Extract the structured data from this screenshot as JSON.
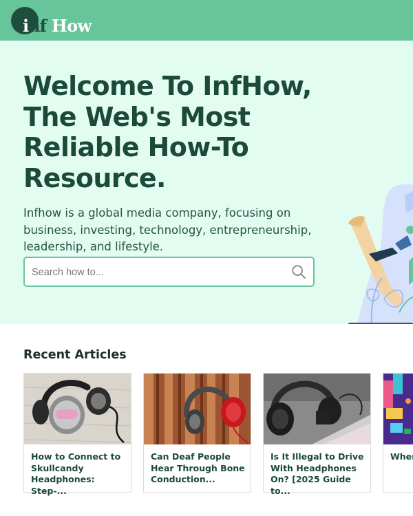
{
  "header": {
    "logo_inf_prefix": "i",
    "logo_inf_suffix": "nf",
    "logo_how": "How",
    "brand_color": "#67c49b",
    "dark_color": "#1f4f3c"
  },
  "hero": {
    "title": "Welcome To InfHow, The Web's Most Reliable How-To Resource.",
    "description": "Infhow is a global media company, focusing on business, investing, technology, entrepreneurship, leadership, and lifestyle.",
    "background": "#e3fcf2"
  },
  "search": {
    "placeholder": "Search how to...",
    "value": "",
    "icon": "search-icon"
  },
  "recent": {
    "title": "Recent Articles",
    "articles": [
      {
        "title": "How to Connect to Skullcandy Headphones: Step-...",
        "image": "headphones-on-wood-image"
      },
      {
        "title": "Can Deaf People Hear Through Bone Conduction...",
        "image": "red-headphones-on-wood-image"
      },
      {
        "title": "Is It Illegal to Drive With Headphones On? [2025 Guide to...",
        "image": "black-headphones-on-tablet-image"
      },
      {
        "title": "When Head Manu",
        "image": "isometric-colorful-illustration-image"
      }
    ]
  }
}
